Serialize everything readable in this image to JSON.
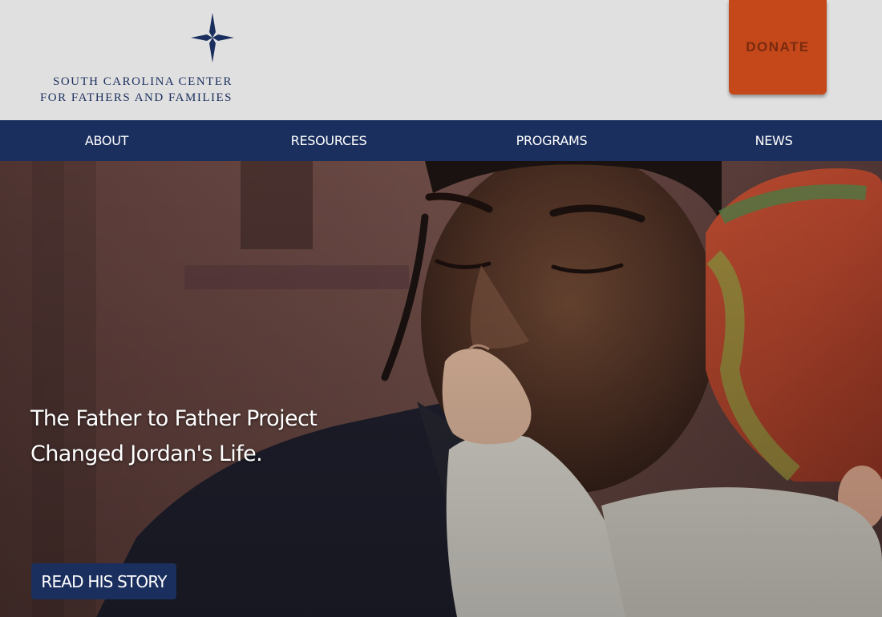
{
  "header": {
    "logo": {
      "line1": "SOUTH CAROLINA CENTER",
      "line2": "FOR FATHERS AND FAMILIES",
      "icon": "compass-star-icon",
      "color": "#1b2f5e"
    },
    "donate_label": "DONATE",
    "donate_color": "#c4481a"
  },
  "nav": {
    "background": "#1b2f5e",
    "items": [
      {
        "label": "ABOUT"
      },
      {
        "label": "RESOURCES"
      },
      {
        "label": "PROGRAMS"
      },
      {
        "label": "NEWS"
      }
    ]
  },
  "hero": {
    "image": "father-kissing-baby-hand-photo",
    "headline_line1": "The Father to Father Project",
    "headline_line2": "Changed Jordan's Life.",
    "cta_label": "READ HIS STORY"
  }
}
